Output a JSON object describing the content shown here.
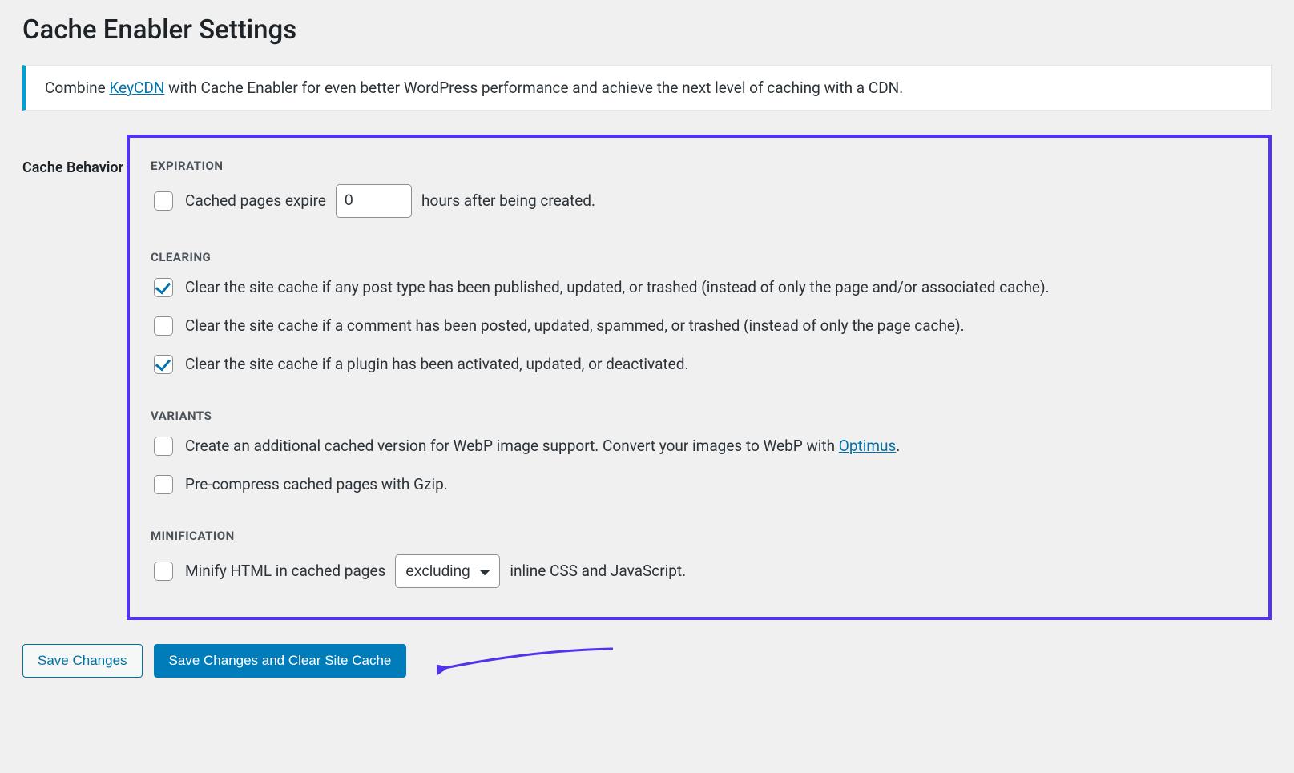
{
  "page": {
    "title": "Cache Enabler Settings"
  },
  "notice": {
    "before": "Combine ",
    "link_text": "KeyCDN",
    "after": " with Cache Enabler for even better WordPress performance and achieve the next level of caching with a CDN."
  },
  "section": {
    "label": "Cache Behavior"
  },
  "expiration": {
    "heading": "EXPIRATION",
    "label_before": "Cached pages expire",
    "value": "0",
    "label_after": "hours after being created.",
    "checked": false
  },
  "clearing": {
    "heading": "CLEARING",
    "items": [
      {
        "checked": true,
        "label": "Clear the site cache if any post type has been published, updated, or trashed (instead of only the page and/or associated cache)."
      },
      {
        "checked": false,
        "label": "Clear the site cache if a comment has been posted, updated, spammed, or trashed (instead of only the page cache)."
      },
      {
        "checked": true,
        "label": "Clear the site cache if a plugin has been activated, updated, or deactivated."
      }
    ]
  },
  "variants": {
    "heading": "VARIANTS",
    "webp_checked": false,
    "webp_before": "Create an additional cached version for WebP image support. Convert your images to WebP with ",
    "webp_link": "Optimus",
    "webp_after": ".",
    "gzip_checked": false,
    "gzip_label": "Pre-compress cached pages with Gzip."
  },
  "minification": {
    "heading": "MINIFICATION",
    "checked": false,
    "label_before": "Minify HTML in cached pages",
    "select_value": "excluding",
    "label_after": "inline CSS and JavaScript."
  },
  "buttons": {
    "save": "Save Changes",
    "save_clear": "Save Changes and Clear Site Cache"
  }
}
